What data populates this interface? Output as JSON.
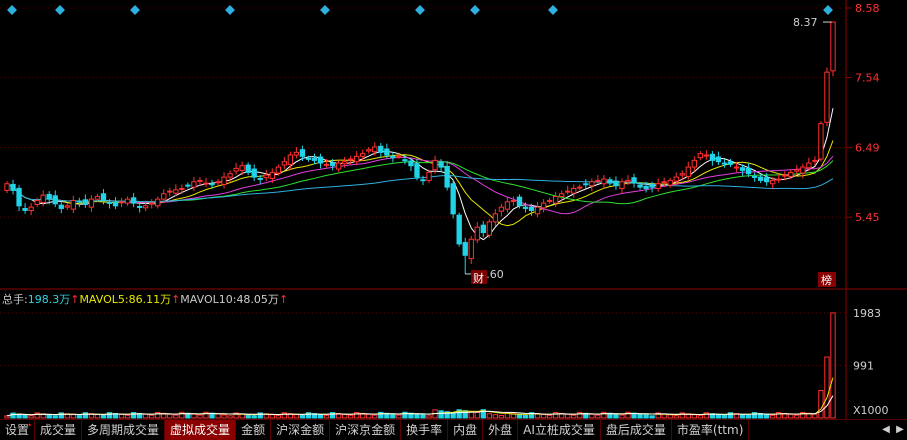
{
  "price_axis": {
    "labels": [
      "8.58",
      "7.54",
      "6.49",
      "5.45"
    ],
    "color": "#ff3030"
  },
  "volume_axis": {
    "labels": [
      "1983",
      "991",
      "X1000"
    ]
  },
  "price_annotations": {
    "high": "8.37",
    "low": "4.60",
    "badge_cai": "财",
    "badge_bang": "榜"
  },
  "volume_header": {
    "total_label": "总手:",
    "total_value": "198.3万",
    "mavol5_label": "MAVOL5:",
    "mavol5_value": "86.11万",
    "mavol10_label": "MAVOL10:",
    "mavol10_value": "48.05万",
    "arrow": "↑"
  },
  "tabs": [
    {
      "label": "设置",
      "dot": "•"
    },
    {
      "label": "成交量"
    },
    {
      "label": "多周期成交量"
    },
    {
      "label": "虚拟成交量",
      "active": true
    },
    {
      "label": "金额"
    },
    {
      "label": "沪深金额"
    },
    {
      "label": "沪深京金额"
    },
    {
      "label": "换手率"
    },
    {
      "label": "内盘"
    },
    {
      "label": "外盘"
    },
    {
      "label": "AI立桩成交量"
    },
    {
      "label": "盘后成交量"
    },
    {
      "label": "市盈率(ttm)"
    }
  ],
  "tab_nav": {
    "left": "◀",
    "right": "▶"
  },
  "colors": {
    "up": "#ff3030",
    "down": "#21d3e6",
    "ma5": "#ffffff",
    "ma10": "#e8e800",
    "ma20": "#e040e0",
    "ma30": "#30e030",
    "ma60": "#2fb0e0",
    "grid": "#8b0000"
  },
  "chart_data": {
    "type": "candlestick",
    "y_axis_ticks": [
      8.58,
      7.54,
      6.49,
      5.45
    ],
    "ylim": [
      4.45,
      8.58
    ],
    "high_mark": 8.37,
    "low_mark": 4.6,
    "volume_ticks": [
      1983,
      991
    ],
    "volume_unit": "X1000",
    "volume_ylim": [
      0,
      2000
    ],
    "closes": [
      5.95,
      5.85,
      5.62,
      5.55,
      5.6,
      5.7,
      5.78,
      5.72,
      5.65,
      5.58,
      5.62,
      5.7,
      5.68,
      5.64,
      5.72,
      5.76,
      5.7,
      5.66,
      5.62,
      5.68,
      5.72,
      5.66,
      5.6,
      5.62,
      5.66,
      5.72,
      5.8,
      5.84,
      5.86,
      5.88,
      5.92,
      5.98,
      6.0,
      5.96,
      5.94,
      5.98,
      6.05,
      6.1,
      6.18,
      6.22,
      6.12,
      6.05,
      6.02,
      6.08,
      6.12,
      6.2,
      6.28,
      6.38,
      6.42,
      6.36,
      6.32,
      6.3,
      6.26,
      6.24,
      6.22,
      6.26,
      6.28,
      6.32,
      6.36,
      6.4,
      6.46,
      6.5,
      6.42,
      6.38,
      6.34,
      6.36,
      6.3,
      6.22,
      6.05,
      6.0,
      6.12,
      6.3,
      6.2,
      5.9,
      5.5,
      5.05,
      4.88,
      5.12,
      5.3,
      5.22,
      5.38,
      5.5,
      5.6,
      5.68,
      5.7,
      5.62,
      5.58,
      5.55,
      5.6,
      5.66,
      5.7,
      5.76,
      5.8,
      5.84,
      5.88,
      5.9,
      5.94,
      5.98,
      6.0,
      6.02,
      5.96,
      5.92,
      5.98,
      6.0,
      5.96,
      5.9,
      5.88,
      5.9,
      5.95,
      5.98,
      6.0,
      6.05,
      6.1,
      6.2,
      6.3,
      6.4,
      6.38,
      6.3,
      6.28,
      6.26,
      6.24,
      6.2,
      6.15,
      6.1,
      6.05,
      6.0,
      5.98,
      6.0,
      6.02,
      6.08,
      6.12,
      6.16,
      6.2,
      6.26,
      6.3,
      6.85,
      7.62,
      8.37
    ]
  }
}
